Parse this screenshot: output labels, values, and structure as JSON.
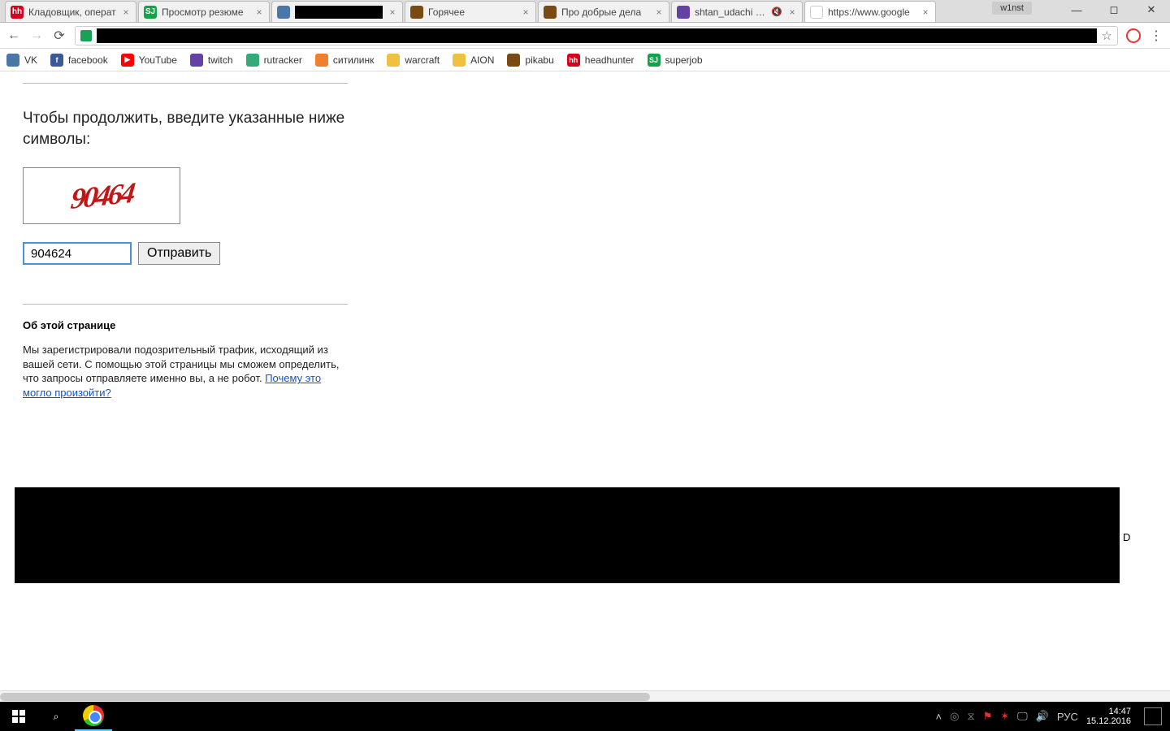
{
  "window": {
    "user_badge": "w1nst"
  },
  "tabs": [
    {
      "title": "Кладовщик, операт",
      "fav": "hh",
      "favclass": "fv-hh"
    },
    {
      "title": "Просмотр резюме",
      "fav": "SJ",
      "favclass": "fv-sj"
    },
    {
      "title": "",
      "fav": "",
      "favclass": "fv-vk",
      "redact": true
    },
    {
      "title": "Горячее",
      "fav": "",
      "favclass": "fv-pb"
    },
    {
      "title": "Про добрые дела",
      "fav": "",
      "favclass": "fv-pb"
    },
    {
      "title": "shtan_udachi - Tv",
      "fav": "",
      "favclass": "fv-tw",
      "muted": true
    },
    {
      "title": "https://www.google",
      "fav": "G",
      "favclass": "fv-gg",
      "active": true
    }
  ],
  "bookmarks": [
    {
      "label": "VK",
      "favclass": "fv-vk",
      "fav": ""
    },
    {
      "label": "facebook",
      "favclass": "fv-fb",
      "fav": "f"
    },
    {
      "label": "YouTube",
      "favclass": "fv-yt",
      "fav": "▶"
    },
    {
      "label": "twitch",
      "favclass": "fv-tw",
      "fav": ""
    },
    {
      "label": "rutracker",
      "favclass": "fv-rt",
      "fav": ""
    },
    {
      "label": "ситилинк",
      "favclass": "fv-ct",
      "fav": ""
    },
    {
      "label": "warcraft",
      "favclass": "fv-wc",
      "fav": ""
    },
    {
      "label": "AION",
      "favclass": "fv-ai",
      "fav": ""
    },
    {
      "label": "pikabu",
      "favclass": "fv-pb",
      "fav": ""
    },
    {
      "label": "headhunter",
      "favclass": "fv-hh",
      "fav": "hh"
    },
    {
      "label": "superjob",
      "favclass": "fv-sj",
      "fav": "SJ"
    }
  ],
  "page": {
    "prompt": "Чтобы продолжить, введите указанные ниже символы:",
    "captcha_text": "90464",
    "input_value": "904624",
    "submit_label": "Отправить",
    "about_heading": "Об этой странице",
    "about_text": "Мы зарегистрировали подозрительный трафик, исходящий из вашей сети. С помощью этой страницы мы сможем определить, что запросы отправляете именно вы, а не робот. ",
    "about_link": "Почему это могло произойти?",
    "side_letter": "D"
  },
  "taskbar": {
    "lang": "РУС",
    "time": "14:47",
    "date": "15.12.2016"
  }
}
